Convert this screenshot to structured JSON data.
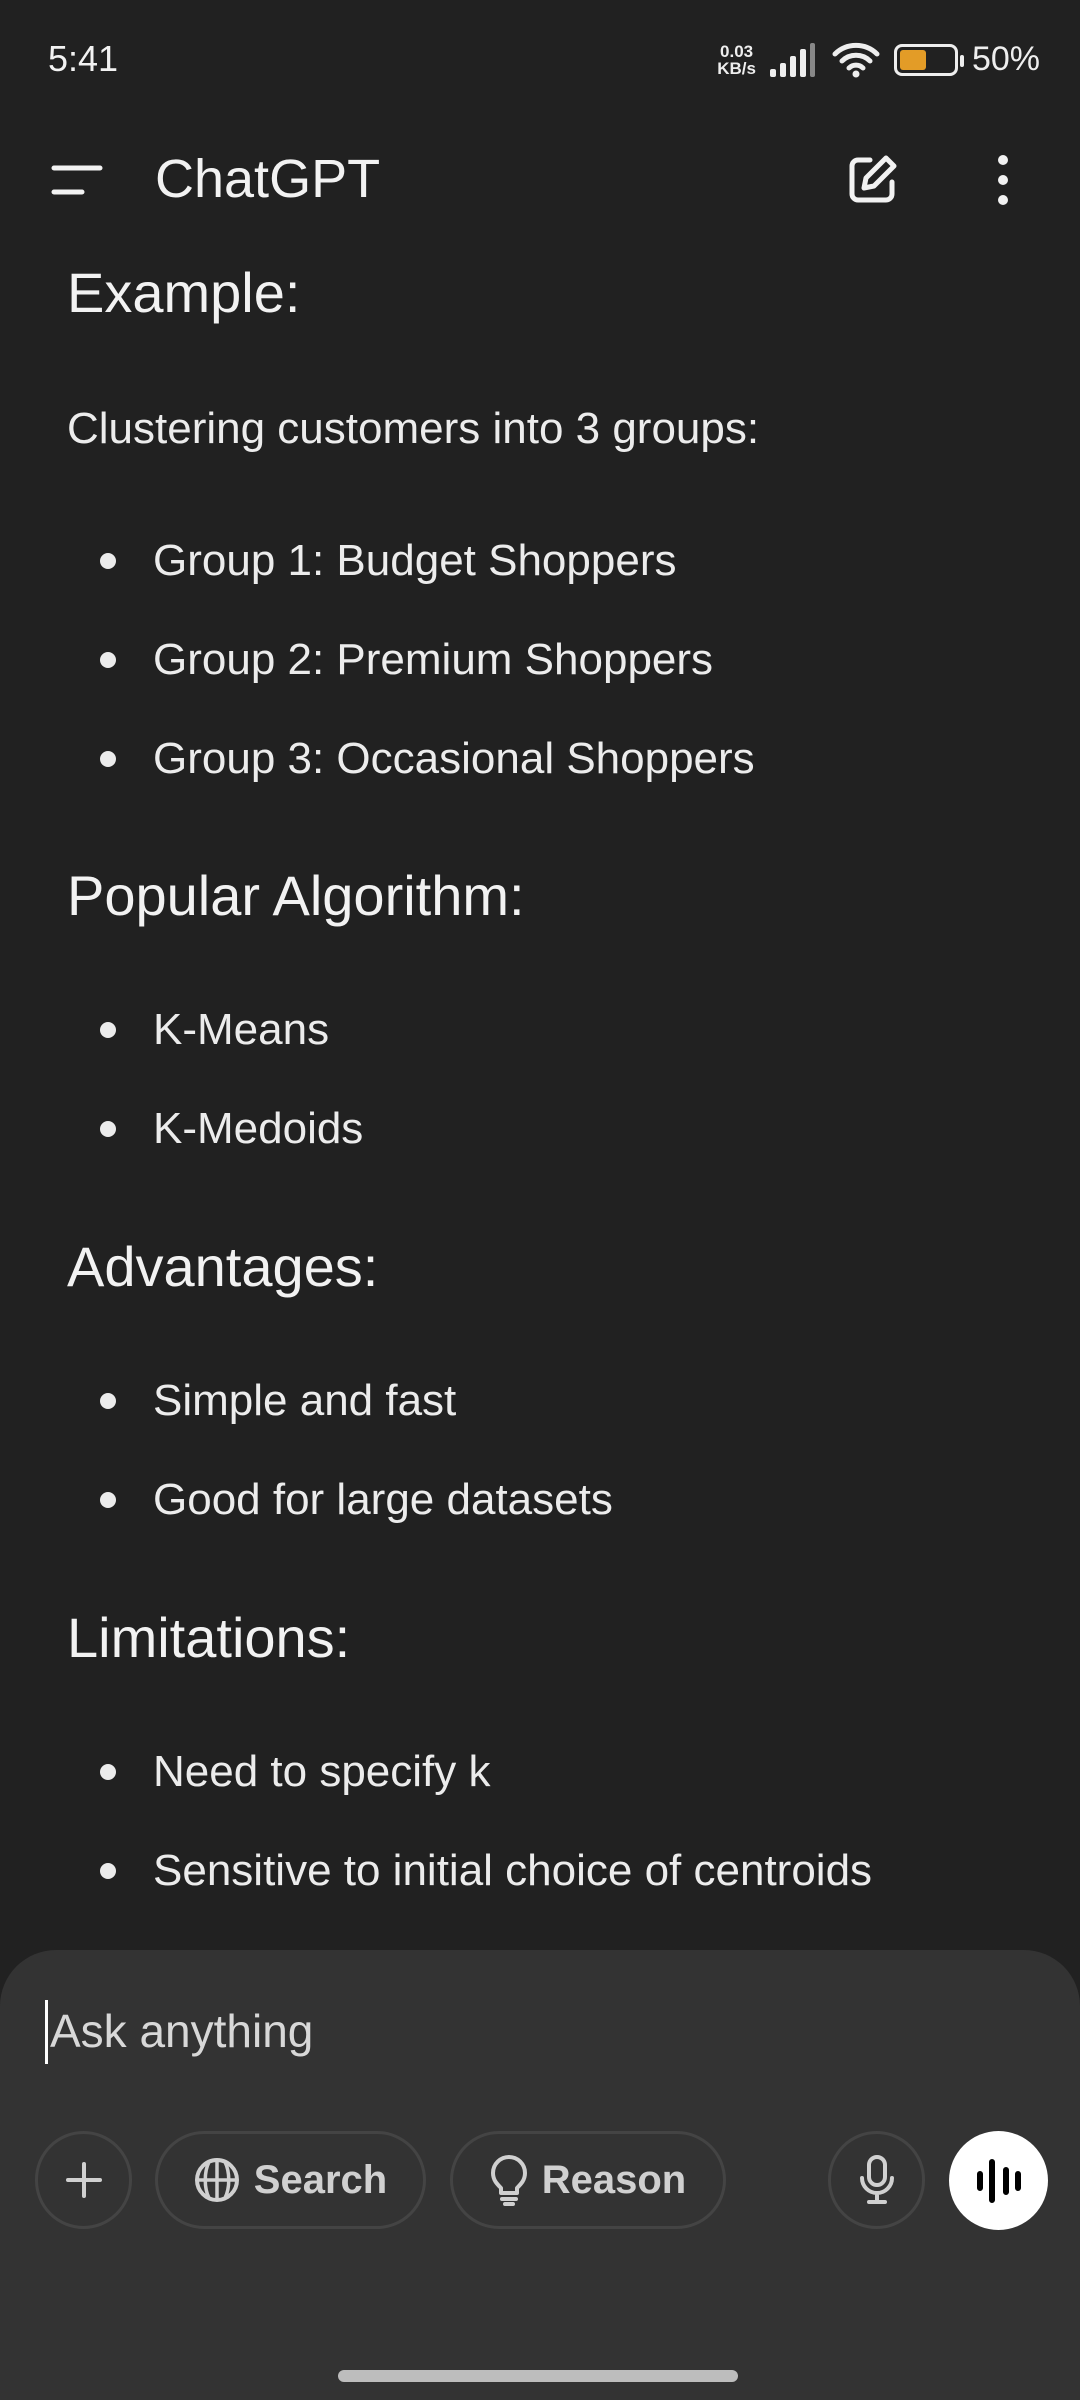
{
  "status_bar": {
    "time": "5:41",
    "net_speed_value": "0.03",
    "net_speed_unit": "KB/s",
    "battery_percent": "50%",
    "battery_level": 0.5,
    "battery_color": "#e39c27"
  },
  "header": {
    "title": "ChatGPT",
    "menu_icon": "hamburger-icon",
    "new_chat_icon": "edit-icon",
    "more_icon": "more-vert-icon"
  },
  "message": {
    "example_heading": "Example:",
    "example_intro": "Clustering customers into 3 groups:",
    "example_items": [
      "Group 1: Budget Shoppers",
      "Group 2: Premium Shoppers",
      "Group 3: Occasional Shoppers"
    ],
    "algorithm_heading": "Popular Algorithm:",
    "algorithm_items": [
      "K-Means",
      "K-Medoids"
    ],
    "advantages_heading": "Advantages:",
    "advantages_items": [
      "Simple and fast",
      "Good for large datasets"
    ],
    "limitations_heading": "Limitations:",
    "limitations_items": [
      "Need to specify k",
      "Sensitive to initial choice of centroids"
    ]
  },
  "composer": {
    "placeholder": "Ask anything",
    "search_label": "Search",
    "reason_label": "Reason"
  }
}
